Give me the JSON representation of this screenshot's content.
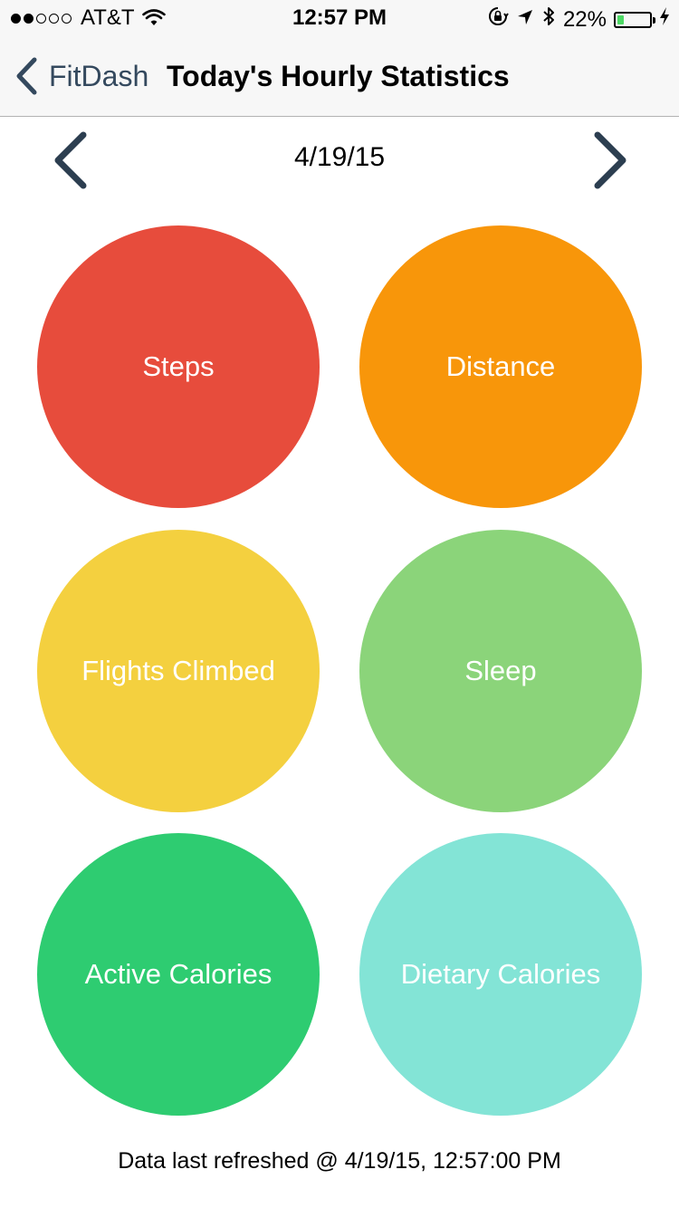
{
  "status_bar": {
    "carrier": "AT&T",
    "time": "12:57 PM",
    "battery_percent": "22%",
    "battery_level": 0.22,
    "signal_bars_filled": 2,
    "signal_bars_total": 5,
    "icons": [
      "wifi-icon",
      "orientation-lock-icon",
      "location-arrow-icon",
      "bluetooth-icon",
      "battery-icon",
      "charging-bolt-icon"
    ]
  },
  "nav": {
    "back_label": "FitDash",
    "title": "Today's Hourly Statistics",
    "tint_color": "#34495e"
  },
  "date_nav": {
    "date": "4/19/15",
    "prev_icon": "chevron-left-icon",
    "next_icon": "chevron-right-icon"
  },
  "tiles": [
    {
      "label": "Steps",
      "color": "#e74c3c"
    },
    {
      "label": "Distance",
      "color": "#f8960a"
    },
    {
      "label": "Flights Climbed",
      "color": "#f4d03f"
    },
    {
      "label": "Sleep",
      "color": "#8bd47a"
    },
    {
      "label": "Active Calories",
      "color": "#2ecc71"
    },
    {
      "label": "Dietary Calories",
      "color": "#83e4d6"
    }
  ],
  "footer": {
    "refreshed_text": "Data last refreshed @ 4/19/15, 12:57:00 PM"
  }
}
